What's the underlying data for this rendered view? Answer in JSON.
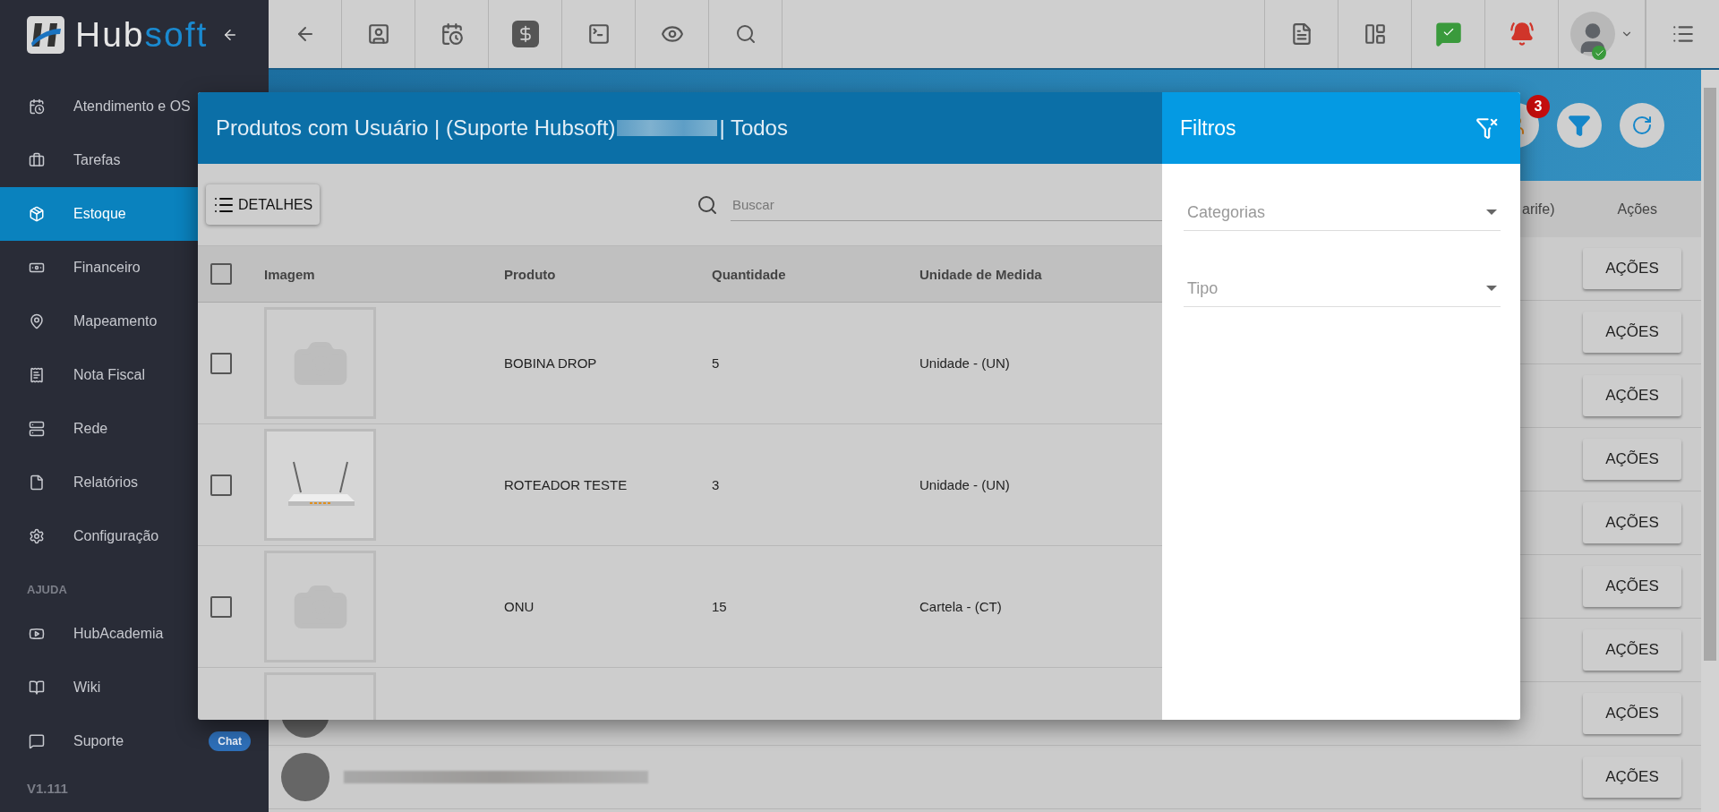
{
  "brand": {
    "first": "Hub",
    "second": "soft"
  },
  "sidebar": {
    "items": [
      {
        "label": "Atendimento e OS",
        "selected": false
      },
      {
        "label": "Tarefas",
        "selected": false
      },
      {
        "label": "Estoque",
        "selected": true
      },
      {
        "label": "Financeiro",
        "selected": false
      },
      {
        "label": "Mapeamento",
        "selected": false
      },
      {
        "label": "Nota Fiscal",
        "selected": false
      },
      {
        "label": "Rede",
        "selected": false
      },
      {
        "label": "Relatórios",
        "selected": false
      },
      {
        "label": "Configuração",
        "selected": false
      }
    ],
    "help_heading": "AJUDA",
    "help_items": [
      {
        "label": "HubAcademia",
        "selected": false
      },
      {
        "label": "Wiki",
        "selected": false
      },
      {
        "label": "Suporte",
        "selected": false,
        "badge": "Chat"
      }
    ],
    "version": "V1.111"
  },
  "notifications": {
    "badge": "3"
  },
  "background_table": {
    "columns": [
      "arife)",
      "Ações"
    ],
    "rows": [
      {
        "action": "AÇÕES"
      },
      {
        "action": "AÇÕES"
      },
      {
        "action": "AÇÕES"
      },
      {
        "action": "AÇÕES"
      },
      {
        "action": "AÇÕES"
      },
      {
        "action": "AÇÕES"
      },
      {
        "action": "AÇÕES"
      },
      {
        "action": "AÇÕES",
        "avatar": true
      },
      {
        "action": "AÇÕES",
        "avatar": true
      }
    ]
  },
  "modal": {
    "title": "Produtos com Usuário | (Suporte Hubsoft)",
    "title_end": "| Todos",
    "details_button": "DETALHES",
    "search": {
      "placeholder": "Buscar"
    },
    "columns": [
      "Imagem",
      "Produto",
      "Quantidade",
      "Unidade de Medida"
    ],
    "select_all": {
      "checked": false
    },
    "rows": [
      {
        "kind": "placeholder",
        "checked": false,
        "product": "BOBINA DROP",
        "quantity": "5",
        "unit": "Unidade - (UN)"
      },
      {
        "kind": "picture",
        "checked": false,
        "product": "ROTEADOR TESTE",
        "quantity": "3",
        "unit": "Unidade - (UN)"
      },
      {
        "kind": "placeholder",
        "checked": false,
        "product": "ONU",
        "quantity": "15",
        "unit": "Cartela - (CT)"
      },
      {
        "kind": "frame"
      }
    ]
  },
  "filters": {
    "title": "Filtros",
    "fields": [
      {
        "placeholder": "Categorias"
      },
      {
        "placeholder": "Tipo"
      }
    ]
  }
}
